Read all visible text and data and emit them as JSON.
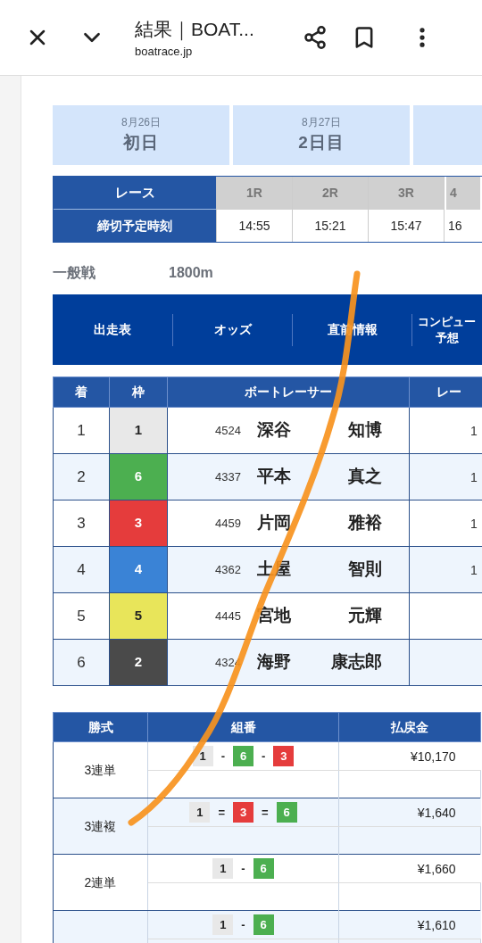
{
  "browser": {
    "title": "結果｜BOAT...",
    "url": "boatrace.jp"
  },
  "days": [
    {
      "date": "8月26日",
      "label": "初日"
    },
    {
      "date": "8月27日",
      "label": "2日目"
    }
  ],
  "race_table": {
    "row_labels": [
      "レース",
      "締切予定時刻"
    ],
    "races": [
      {
        "race": "1R",
        "time": "14:55"
      },
      {
        "race": "2R",
        "time": "15:21"
      },
      {
        "race": "3R",
        "time": "15:47"
      },
      {
        "race": "4",
        "time": "16"
      }
    ]
  },
  "race_info": {
    "type": "一般戦",
    "distance": "1800m"
  },
  "nav": [
    "出走表",
    "オッズ",
    "直前情報",
    "コンピュー予想"
  ],
  "results": {
    "columns": [
      "着",
      "枠",
      "ボートレーサー",
      "レー"
    ],
    "rows": [
      {
        "place": "1",
        "frame": "1",
        "color": "#e8e8e8",
        "reg": "4524",
        "surname": "深谷",
        "given": "知博",
        "column_4": "1"
      },
      {
        "place": "2",
        "frame": "6",
        "color": "#4caf50",
        "reg": "4337",
        "surname": "平本",
        "given": "真之",
        "column_4": "1"
      },
      {
        "place": "3",
        "frame": "3",
        "color": "#e53c3c",
        "reg": "4459",
        "surname": "片岡",
        "given": "雅裕",
        "column_4": "1"
      },
      {
        "place": "4",
        "frame": "4",
        "color": "#3a83d6",
        "reg": "4362",
        "surname": "土屋",
        "given": "智則",
        "column_4": "1"
      },
      {
        "place": "5",
        "frame": "5",
        "color": "#e8e55a",
        "reg": "4445",
        "surname": "宮地",
        "given": "元輝"
      },
      {
        "place": "6",
        "frame": "2",
        "color": "#4a4a4a",
        "reg": "4324",
        "surname": "海野",
        "given": "康志郎"
      }
    ]
  },
  "payouts": {
    "columns": [
      "勝式",
      "組番",
      "払戻金"
    ],
    "rows": [
      {
        "bet_type": "3連単",
        "separator": "-",
        "frames": [
          {
            "number": "1",
            "color": "#e8e8e8"
          },
          {
            "number": "6",
            "color": "#4caf50"
          },
          {
            "number": "3",
            "color": "#e53c3c"
          }
        ],
        "amount": "¥10,170"
      },
      {
        "bet_type": "3連複",
        "separator": "=",
        "frames": [
          {
            "number": "1",
            "color": "#e8e8e8"
          },
          {
            "number": "3",
            "color": "#e53c3c"
          },
          {
            "number": "6",
            "color": "#4caf50"
          }
        ],
        "amount": "¥1,640"
      },
      {
        "bet_type": "2連単",
        "separator": "-",
        "frames": [
          {
            "number": "1",
            "color": "#e8e8e8"
          },
          {
            "number": "6",
            "color": "#4caf50"
          }
        ],
        "amount": "¥1,660"
      },
      {
        "separator": "-",
        "frames": [
          {
            "number": "1",
            "color": "#e8e8e8"
          },
          {
            "number": "6",
            "color": "#4caf50"
          }
        ],
        "amount": "¥1,610"
      }
    ]
  }
}
